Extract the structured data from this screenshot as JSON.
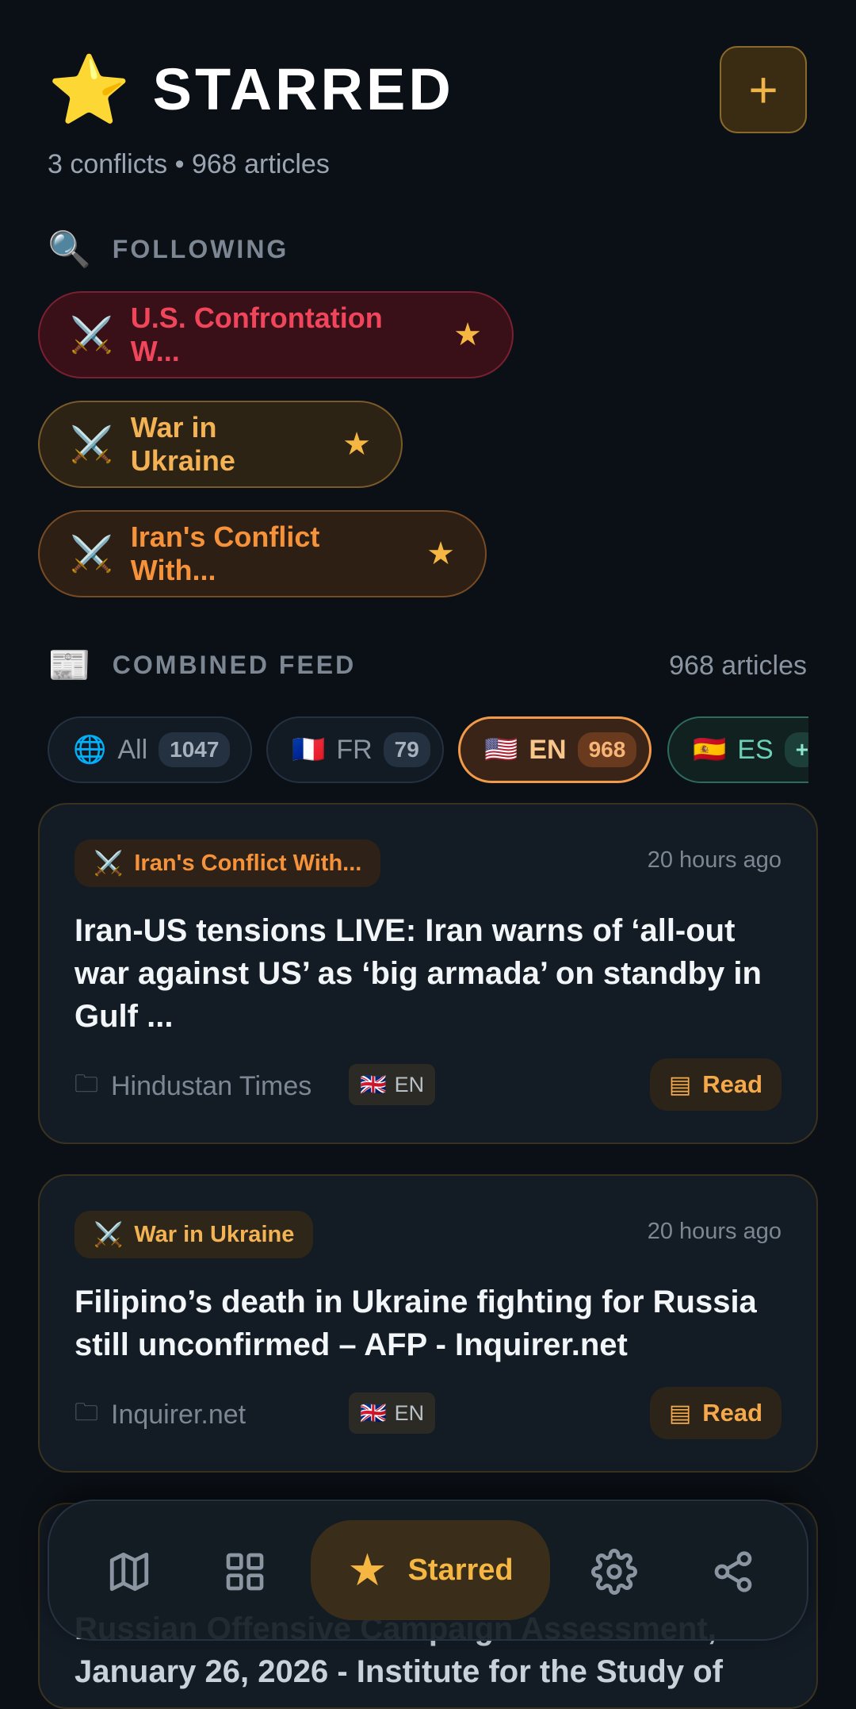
{
  "header": {
    "star_emoji": "⭐",
    "title": "STARRED",
    "add_label": "+",
    "subtitle": "3 conflicts • 968 articles"
  },
  "following": {
    "icon": "🔍",
    "label": "FOLLOWING",
    "items": [
      {
        "icon": "⚔️",
        "label": "U.S. Confrontation W...",
        "star": "★",
        "color": "#f0455a"
      },
      {
        "icon": "⚔️",
        "label": "War in Ukraine",
        "star": "★",
        "color": "#f3b253"
      },
      {
        "icon": "⚔️",
        "label": "Iran's Conflict With...",
        "star": "★",
        "color": "#f5923a"
      }
    ]
  },
  "feed": {
    "icon": "📰",
    "label": "COMBINED FEED",
    "count_label": "968 articles",
    "tabs": [
      {
        "flag": "🌐",
        "label": "All",
        "count": "1047"
      },
      {
        "flag": "🇫🇷",
        "label": "FR",
        "count": "79"
      },
      {
        "flag": "🇺🇸",
        "label": "EN",
        "count": "968",
        "selected": true
      },
      {
        "flag": "🇪🇸",
        "label": "ES",
        "count": "+"
      }
    ]
  },
  "articles": [
    {
      "tag_icon": "⚔️",
      "tag": "Iran's Conflict With...",
      "time": "20 hours ago",
      "headline": "Iran-US tensions LIVE: Iran warns of ‘all-out war against US’ as ‘big armada’ on standby in Gulf ...",
      "source_icon": "🗀",
      "source": "Hindustan Times",
      "lang_flag": "🇬🇧",
      "lang": "EN",
      "read_icon": "▤",
      "read_label": "Read"
    },
    {
      "tag_icon": "⚔️",
      "tag": "War in Ukraine",
      "time": "20 hours ago",
      "headline": "Filipino’s death in Ukraine fighting for Russia still unconfirmed – AFP - Inquirer.net",
      "source_icon": "🗀",
      "source": "Inquirer.net",
      "lang_flag": "🇬🇧",
      "lang": "EN",
      "read_icon": "▤",
      "read_label": "Read"
    },
    {
      "headline": "Russian Offensive Campaign Assessment, January 26, 2026 - Institute for the Study of"
    }
  ],
  "nav": {
    "map": "map-icon",
    "grid": "grid-icon",
    "starred_icon": "★",
    "starred_label": "Starred",
    "settings": "gear-icon",
    "share": "share-icon"
  },
  "colors": {
    "background": "#0b1016",
    "accent": "#f5b642",
    "red": "#f0455a",
    "orange": "#f5923a"
  }
}
